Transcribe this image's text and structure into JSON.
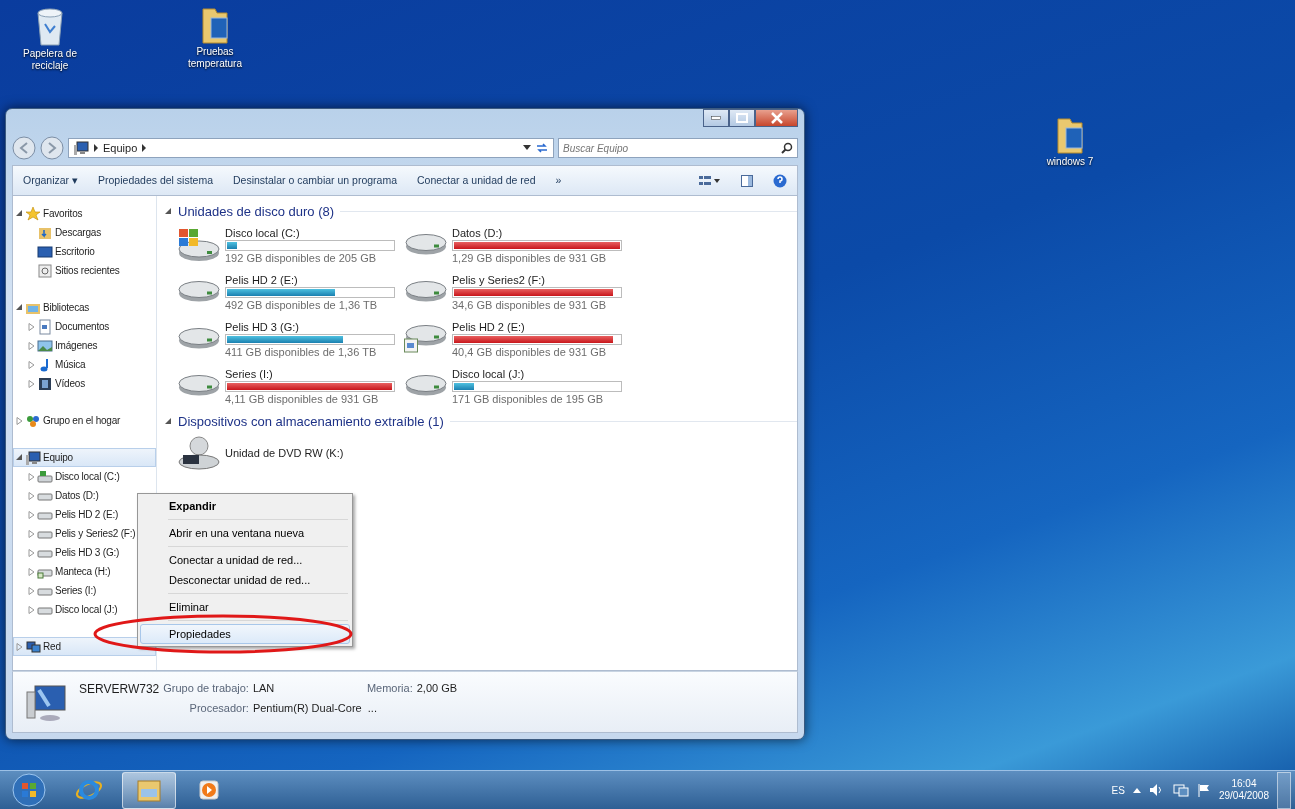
{
  "desktop_icons": [
    {
      "label": "Papelera de reciclaje",
      "kind": "recycle"
    },
    {
      "label": "Pruebas temperatura",
      "kind": "folder"
    },
    {
      "label": "windows 7",
      "kind": "folder"
    }
  ],
  "window": {
    "address": "Equipo",
    "search": {
      "placeholder": "Buscar Equipo"
    },
    "toolbar": [
      "Organizar ▾",
      "Propiedades del sistema",
      "Desinstalar o cambiar un programa",
      "Conectar a unidad de red",
      "»"
    ],
    "sidebar": [
      {
        "label": "Favoritos",
        "kind": "star",
        "expanded": true,
        "selected": false,
        "children": [
          {
            "label": "Descargas",
            "kind": "downloads",
            "selected": false
          },
          {
            "label": "Escritorio",
            "kind": "desktop",
            "selected": false
          },
          {
            "label": "Sitios recientes",
            "kind": "recent",
            "selected": false
          }
        ]
      },
      {
        "label": "Bibliotecas",
        "kind": "library",
        "expanded": true,
        "selected": false,
        "children": [
          {
            "label": "Documentos",
            "kind": "document",
            "expanded": false,
            "selected": false
          },
          {
            "label": "Imágenes",
            "kind": "image",
            "expanded": false,
            "selected": false
          },
          {
            "label": "Música",
            "kind": "music",
            "expanded": false,
            "selected": false
          },
          {
            "label": "Vídeos",
            "kind": "video",
            "expanded": false,
            "selected": false
          }
        ]
      },
      {
        "label": "Grupo en el hogar",
        "kind": "homegroup",
        "expanded": false,
        "selected": false
      },
      {
        "label": "Equipo",
        "kind": "computer",
        "expanded": true,
        "selected": true,
        "children": [
          {
            "label": "Disco local (C:)",
            "kind": "system",
            "expanded": false,
            "selected": false
          },
          {
            "label": "Datos (D:)",
            "kind": "hdd",
            "expanded": false,
            "selected": false
          },
          {
            "label": "Pelis HD 2 (E:)",
            "kind": "hdd",
            "expanded": false,
            "selected": false
          },
          {
            "label": "Pelis y Series2 (F:)",
            "kind": "hdd",
            "expanded": false,
            "selected": false
          },
          {
            "label": "Pelis HD 3 (G:)",
            "kind": "hdd",
            "expanded": false,
            "selected": false
          },
          {
            "label": "Manteca (H:)",
            "kind": "shared",
            "expanded": false,
            "selected": false
          },
          {
            "label": "Series (I:)",
            "kind": "hdd",
            "expanded": false,
            "selected": false
          },
          {
            "label": "Disco local (J:)",
            "kind": "hdd",
            "expanded": false,
            "selected": false
          }
        ]
      },
      {
        "label": "Red",
        "kind": "network",
        "expanded": false,
        "selected": true
      }
    ],
    "sections": [
      {
        "title": "Unidades de disco duro (8)",
        "expanded": true,
        "items": [
          {
            "name": "Disco local (C:)",
            "kind": "system",
            "level": 0.06,
            "free": "192 GB disponibles de 205 GB"
          },
          {
            "name": "Datos (D:)",
            "kind": "hdd",
            "level": 0.999,
            "free": "1,29 GB disponibles de 931 GB"
          },
          {
            "name": "Pelis HD 2 (E:)",
            "kind": "hdd",
            "level": 0.65,
            "free": "492 GB disponibles de 1,36 TB"
          },
          {
            "name": "Pelis y Series2 (F:)",
            "kind": "hdd",
            "level": 0.96,
            "free": "34,6 GB disponibles de 931 GB"
          },
          {
            "name": "Pelis HD 3 (G:)",
            "kind": "hdd",
            "level": 0.7,
            "free": "411 GB disponibles de 1,36 TB"
          },
          {
            "name": "Pelis HD 2 (E:)",
            "kind": "shared",
            "level": 0.96,
            "free": "40,4 GB disponibles de 931 GB"
          },
          {
            "name": "Series (I:)",
            "kind": "hdd",
            "level": 0.996,
            "free": "4,11 GB disponibles de 931 GB"
          },
          {
            "name": "Disco local (J:)",
            "kind": "hdd",
            "level": 0.12,
            "free": "171 GB disponibles de 195 GB"
          }
        ]
      },
      {
        "title": "Dispositivos con almacenamiento extraíble (1)",
        "expanded": true,
        "items": [
          {
            "name": "Unidad de DVD RW (K:)",
            "kind": "dvd"
          }
        ]
      }
    ],
    "details": {
      "computer": "SERVERW732",
      "fields": [
        {
          "label": "Grupo de trabajo:",
          "value": "LAN"
        },
        {
          "label": "Memoria:",
          "value": "2,00 GB"
        },
        {
          "label": "Procesador:",
          "value": "Pentium(R) Dual-Core  ..."
        }
      ]
    }
  },
  "context_menu": [
    [
      {
        "label": "Expandir",
        "bold": true,
        "highlighted": false
      }
    ],
    [
      {
        "label": "Abrir en una ventana nueva",
        "bold": false,
        "highlighted": false
      }
    ],
    [
      {
        "label": "Conectar a unidad de red...",
        "bold": false,
        "highlighted": false
      },
      {
        "label": "Desconectar unidad de red...",
        "bold": false,
        "highlighted": false
      }
    ],
    [
      {
        "label": "Eliminar",
        "bold": false,
        "highlighted": false
      }
    ],
    [
      {
        "label": "Propiedades",
        "bold": false,
        "highlighted": true
      }
    ]
  ],
  "taskbar": [
    {
      "kind": "start",
      "active": false
    },
    {
      "kind": "browser",
      "active": false
    },
    {
      "kind": "explorer",
      "active": true
    },
    {
      "kind": "media",
      "active": false
    }
  ],
  "tray": {
    "language": "ES",
    "time": "16:04",
    "date": "29/04/2008"
  }
}
